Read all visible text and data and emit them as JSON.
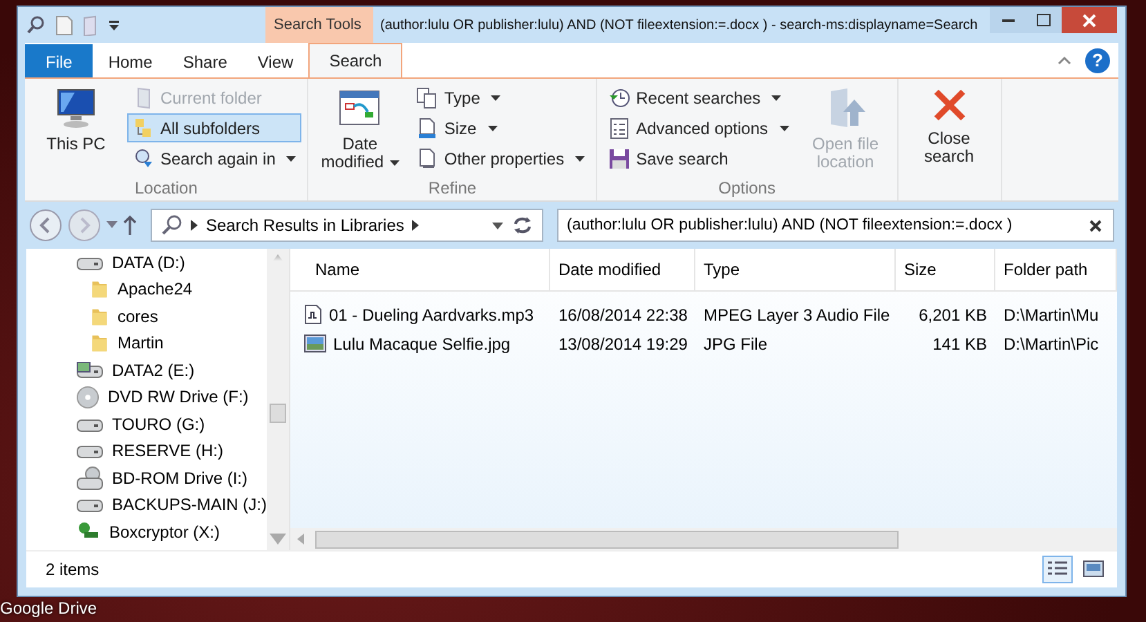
{
  "desktop": {
    "icon_labels": [
      "Google Drive"
    ]
  },
  "window": {
    "title": "(author:lulu OR publisher:lulu) AND (NOT fileextension:=.docx ) - search-ms:displayname=Search"
  },
  "contextual_tab_header": "Search Tools",
  "help_button": "?",
  "tabs": [
    {
      "label": "File",
      "kind": "file",
      "selected": false
    },
    {
      "label": "Home",
      "kind": "normal",
      "selected": false
    },
    {
      "label": "Share",
      "kind": "normal",
      "selected": false
    },
    {
      "label": "View",
      "kind": "normal",
      "selected": false
    },
    {
      "label": "Search",
      "kind": "contextual",
      "selected": true
    }
  ],
  "ribbon": {
    "groups": [
      {
        "label": "Location",
        "items": [
          {
            "kind": "large",
            "label": "This PC",
            "disabled": false,
            "dropdown": false
          },
          {
            "kind": "small",
            "label": "Current folder",
            "disabled": true,
            "selected": false,
            "dropdown": false
          },
          {
            "kind": "small",
            "label": "All subfolders",
            "disabled": false,
            "selected": true,
            "dropdown": false
          },
          {
            "kind": "small",
            "label": "Search again in",
            "disabled": false,
            "dropdown": true
          }
        ]
      },
      {
        "label": "Refine",
        "items": [
          {
            "kind": "large",
            "label": "Date modified",
            "disabled": false,
            "dropdown": true
          },
          {
            "kind": "small",
            "label": "Type",
            "disabled": false,
            "dropdown": true
          },
          {
            "kind": "small",
            "label": "Size",
            "disabled": false,
            "dropdown": true
          },
          {
            "kind": "small",
            "label": "Other properties",
            "disabled": false,
            "dropdown": true
          }
        ]
      },
      {
        "label": "Options",
        "items": [
          {
            "kind": "small",
            "label": "Recent searches",
            "disabled": false,
            "dropdown": true
          },
          {
            "kind": "small",
            "label": "Advanced options",
            "disabled": false,
            "dropdown": true
          },
          {
            "kind": "small",
            "label": "Save search",
            "disabled": false,
            "dropdown": false
          },
          {
            "kind": "large",
            "label": "Open file location",
            "disabled": true,
            "dropdown": false
          }
        ]
      },
      {
        "items": [
          {
            "kind": "large",
            "label": "Close search",
            "disabled": false,
            "dropdown": false
          }
        ]
      }
    ]
  },
  "address_bar": {
    "breadcrumb": "Search Results in Libraries"
  },
  "search_box": {
    "value": "(author:lulu OR publisher:lulu) AND (NOT fileextension:=.docx )"
  },
  "navigation": {
    "items": [
      {
        "label": "DATA (D:)",
        "kind": "drive",
        "children": [
          {
            "label": "Apache24",
            "kind": "folder"
          },
          {
            "label": "cores",
            "kind": "folder"
          },
          {
            "label": "Martin",
            "kind": "folder"
          }
        ]
      },
      {
        "label": "DATA2 (E:)",
        "kind": "tagged-drive"
      },
      {
        "label": "DVD RW Drive (F:)",
        "kind": "disc"
      },
      {
        "label": "TOURO (G:)",
        "kind": "drive"
      },
      {
        "label": "RESERVE (H:)",
        "kind": "drive"
      },
      {
        "label": "BD-ROM Drive (I:)",
        "kind": "optical"
      },
      {
        "label": "BACKUPS-MAIN (J:)",
        "kind": "drive"
      },
      {
        "label": "Boxcryptor (X:)",
        "kind": "encrypted"
      }
    ]
  },
  "table": {
    "columns": [
      "Name",
      "Date modified",
      "Type",
      "Size",
      "Folder path"
    ],
    "rows": [
      {
        "kind": "audio",
        "name": "01 - Dueling Aardvarks.mp3",
        "date_modified": "16/08/2014 22:38",
        "type": "MPEG Layer 3 Audio File",
        "size": "6,201 KB",
        "folder_path": "D:\\Martin\\Mu"
      },
      {
        "kind": "image",
        "name": "Lulu Macaque Selfie.jpg",
        "date_modified": "13/08/2014 19:29",
        "type": "JPG File",
        "size": "141 KB",
        "folder_path": "D:\\Martin\\Pic"
      }
    ]
  },
  "status_bar": {
    "item_count": "2 items",
    "views": [
      {
        "kind": "details",
        "selected": true
      },
      {
        "kind": "large-icons",
        "selected": false
      }
    ]
  }
}
